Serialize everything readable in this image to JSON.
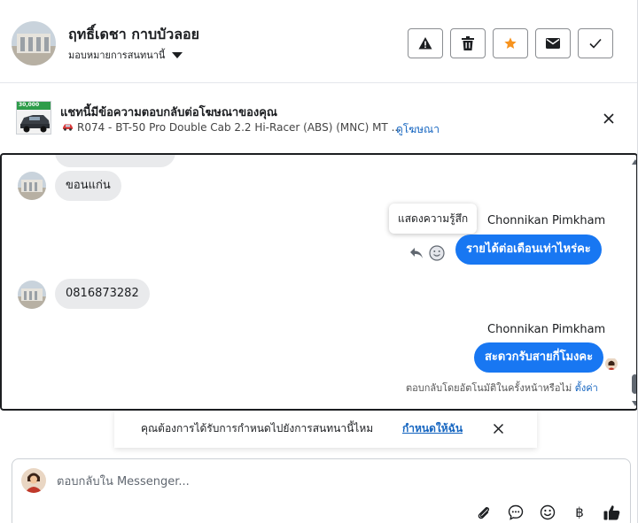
{
  "header": {
    "name": "ฤทธิ์เดชา กาบบัวลอย",
    "assign_label": "มอบหมายการสนทนานี้",
    "actions": [
      "spam",
      "delete",
      "star",
      "mark-unread",
      "done"
    ],
    "star_color": "#f7931e"
  },
  "ad": {
    "thumb_price": "30,000",
    "title": "แชทนี้มีข้อความตอบกลับต่อโฆษณาของคุณ",
    "subtitle": "R074 - BT-50 Pro Double Cab 2.2 Hi-Racer (ABS) (MNC) MT ...",
    "link": "ดูโฆษณา"
  },
  "chat": {
    "messages": [
      {
        "side": "in",
        "text": "ขอนแก่น"
      },
      {
        "side": "out",
        "sender": "Chonnikan Pimkham",
        "text": "รายได้ต่อเดือนเท่าไหร่คะ"
      },
      {
        "side": "in",
        "text": "0816873282"
      },
      {
        "side": "out",
        "sender": "Chonnikan Pimkham",
        "text": "สะดวกรับสายกี่โมงคะ"
      }
    ],
    "tooltip": "แสดงความรู้สึก",
    "auto_reply_note": "ตอบกลับโดยอัตโนมัติในครั้งหน้าหรือไม่",
    "auto_reply_link": "ตั้งค่า",
    "out_bubble_color": "#1877f2"
  },
  "suggest": {
    "text": "คุณต้องการได้รับการกำหนดไปยังการสนทนานี้ไหม",
    "link": "กำหนดให้ฉัน"
  },
  "composer": {
    "placeholder": "ตอบกลับใน Messenger...",
    "tools": [
      "attach-icon",
      "chat-icon",
      "emoji-icon",
      "baht-icon",
      "like-icon"
    ],
    "baht_symbol": "฿"
  }
}
